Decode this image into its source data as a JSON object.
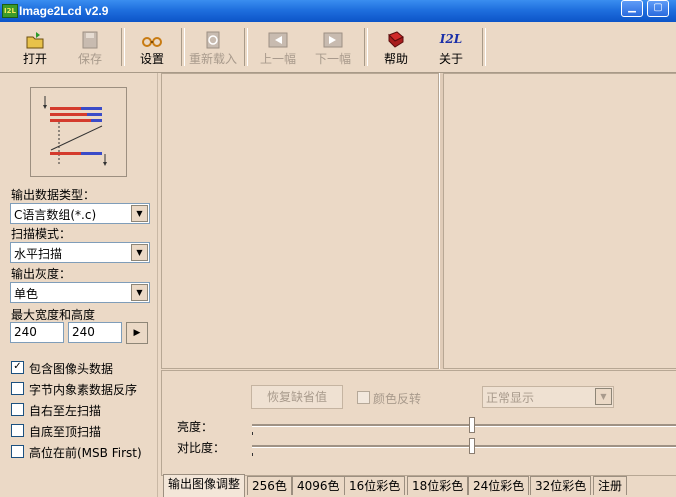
{
  "window": {
    "title": "Image2Lcd v2.9",
    "app_icon_text": "I2L"
  },
  "toolbar": {
    "open": "打开",
    "save": "保存",
    "settings": "设置",
    "reload": "重新载入",
    "prev": "上一幅",
    "next": "下一幅",
    "help": "帮助",
    "about": "关于",
    "about_logo": "I2L"
  },
  "left": {
    "output_type_label": "输出数据类型：",
    "output_type_value": "C语言数组(*.c)",
    "scan_mode_label": "扫描模式：",
    "scan_mode_value": "水平扫描",
    "gray_label": "输出灰度：",
    "gray_value": "单色",
    "max_size_label": "最大宽度和高度",
    "max_width": "240",
    "max_height": "240",
    "checkboxes": [
      {
        "label": "包含图像头数据",
        "checked": true
      },
      {
        "label": "字节内象素数据反序",
        "checked": false
      },
      {
        "label": "自右至左扫描",
        "checked": false
      },
      {
        "label": "自底至顶扫描",
        "checked": false
      },
      {
        "label": "高位在前(MSB First)",
        "checked": false
      }
    ]
  },
  "adjust": {
    "restore_default": "恢复缺省值",
    "invert_color": "颜色反转",
    "display_mode": "正常显示",
    "brightness_label": "亮度：",
    "contrast_label": "对比度：",
    "brightness": 0.5,
    "contrast": 0.5
  },
  "tabs": [
    "输出图像调整",
    "256色",
    "4096色",
    "16位彩色",
    "18位彩色",
    "24位彩色",
    "32位彩色",
    "注册"
  ]
}
